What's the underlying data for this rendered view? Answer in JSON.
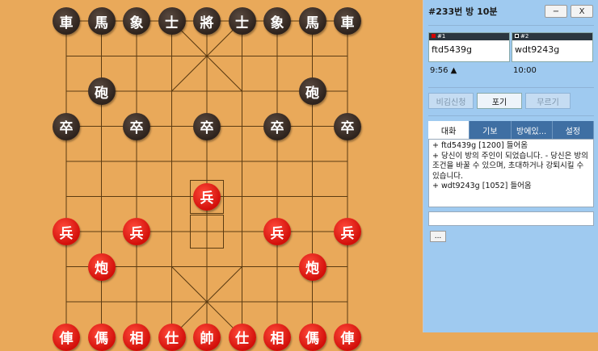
{
  "panel": {
    "title": "#233번 방   10분",
    "minimize_label": "−",
    "close_label": "X",
    "players": [
      {
        "num": "#1",
        "name": "ftd5439g",
        "timer": "9:56 ▲",
        "color": "#d40000"
      },
      {
        "num": "#2",
        "name": "wdt9243g",
        "timer": "10:00",
        "color": "#1a1a1a"
      }
    ],
    "actions": [
      {
        "label": "비김신청",
        "active": false
      },
      {
        "label": "포기",
        "active": true
      },
      {
        "label": "무르기",
        "active": false
      }
    ],
    "tabs": [
      "대화",
      "기보",
      "방에있...",
      "설정"
    ],
    "chat": [
      "+ ftd5439g [1200] 들어옴",
      "+ 당신이 방의 주인이 되었습니다. - 당신은 방의 조건을 바꿀 수 있으며, 초대하거나 강퇴시킬 수 있습니다.",
      "+ wdt9243g [1052] 들어옴"
    ],
    "input_placeholder": "",
    "more_label": "..."
  },
  "board": {
    "pieces": [
      {
        "side": "black",
        "char": "車",
        "file": 0,
        "rank": 0
      },
      {
        "side": "black",
        "char": "馬",
        "file": 1,
        "rank": 0
      },
      {
        "side": "black",
        "char": "象",
        "file": 2,
        "rank": 0
      },
      {
        "side": "black",
        "char": "士",
        "file": 3,
        "rank": 0
      },
      {
        "side": "black",
        "char": "將",
        "file": 4,
        "rank": 0
      },
      {
        "side": "black",
        "char": "士",
        "file": 5,
        "rank": 0
      },
      {
        "side": "black",
        "char": "象",
        "file": 6,
        "rank": 0
      },
      {
        "side": "black",
        "char": "馬",
        "file": 7,
        "rank": 0
      },
      {
        "side": "black",
        "char": "車",
        "file": 8,
        "rank": 0
      },
      {
        "side": "black",
        "char": "砲",
        "file": 1,
        "rank": 2
      },
      {
        "side": "black",
        "char": "砲",
        "file": 7,
        "rank": 2
      },
      {
        "side": "black",
        "char": "卒",
        "file": 0,
        "rank": 3
      },
      {
        "side": "black",
        "char": "卒",
        "file": 2,
        "rank": 3
      },
      {
        "side": "black",
        "char": "卒",
        "file": 4,
        "rank": 3
      },
      {
        "side": "black",
        "char": "卒",
        "file": 6,
        "rank": 3
      },
      {
        "side": "black",
        "char": "卒",
        "file": 8,
        "rank": 3
      },
      {
        "side": "red",
        "char": "兵",
        "file": 4,
        "rank": 5
      },
      {
        "side": "red",
        "char": "兵",
        "file": 0,
        "rank": 6
      },
      {
        "side": "red",
        "char": "兵",
        "file": 2,
        "rank": 6
      },
      {
        "side": "red",
        "char": "兵",
        "file": 6,
        "rank": 6
      },
      {
        "side": "red",
        "char": "兵",
        "file": 8,
        "rank": 6
      },
      {
        "side": "red",
        "char": "炮",
        "file": 1,
        "rank": 7
      },
      {
        "side": "red",
        "char": "炮",
        "file": 7,
        "rank": 7
      },
      {
        "side": "red",
        "char": "俥",
        "file": 0,
        "rank": 9
      },
      {
        "side": "red",
        "char": "傌",
        "file": 1,
        "rank": 9
      },
      {
        "side": "red",
        "char": "相",
        "file": 2,
        "rank": 9
      },
      {
        "side": "red",
        "char": "仕",
        "file": 3,
        "rank": 9
      },
      {
        "side": "red",
        "char": "帥",
        "file": 4,
        "rank": 9
      },
      {
        "side": "red",
        "char": "仕",
        "file": 5,
        "rank": 9
      },
      {
        "side": "red",
        "char": "相",
        "file": 6,
        "rank": 9
      },
      {
        "side": "red",
        "char": "傌",
        "file": 7,
        "rank": 9
      },
      {
        "side": "red",
        "char": "俥",
        "file": 8,
        "rank": 9
      }
    ],
    "last_move": {
      "from": {
        "file": 4,
        "rank": 6
      },
      "to": {
        "file": 4,
        "rank": 5
      }
    },
    "line_color": "#5b3b12"
  }
}
